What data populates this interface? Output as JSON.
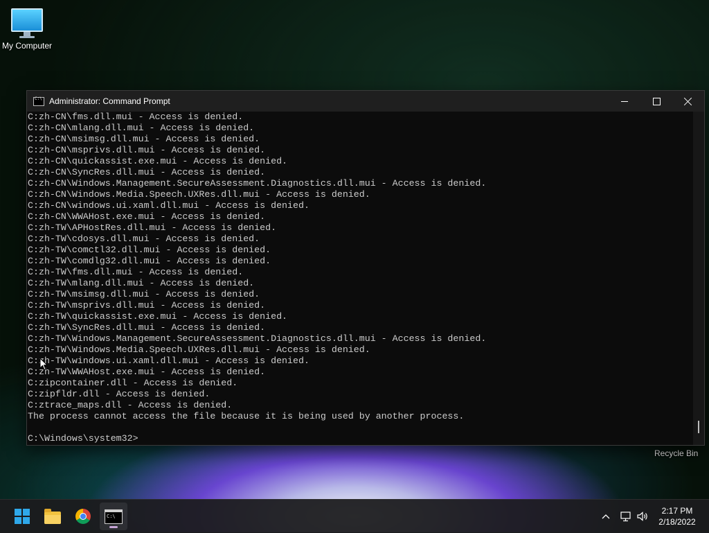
{
  "desktop": {
    "icons": [
      {
        "label": "My Computer",
        "icon": "monitor-icon"
      }
    ],
    "recycle_bin_label": "Recycle Bin"
  },
  "window": {
    "title": "Administrator: Command Prompt",
    "icon": "cmd-icon",
    "controls": {
      "minimize": "minimize-icon",
      "maximize": "maximize-icon",
      "close": "close-icon"
    }
  },
  "console": {
    "lines": [
      "C:zh-CN\\fms.dll.mui - Access is denied.",
      "C:zh-CN\\mlang.dll.mui - Access is denied.",
      "C:zh-CN\\msimsg.dll.mui - Access is denied.",
      "C:zh-CN\\msprivs.dll.mui - Access is denied.",
      "C:zh-CN\\quickassist.exe.mui - Access is denied.",
      "C:zh-CN\\SyncRes.dll.mui - Access is denied.",
      "C:zh-CN\\Windows.Management.SecureAssessment.Diagnostics.dll.mui - Access is denied.",
      "C:zh-CN\\Windows.Media.Speech.UXRes.dll.mui - Access is denied.",
      "C:zh-CN\\windows.ui.xaml.dll.mui - Access is denied.",
      "C:zh-CN\\WWAHost.exe.mui - Access is denied.",
      "C:zh-TW\\APHostRes.dll.mui - Access is denied.",
      "C:zh-TW\\cdosys.dll.mui - Access is denied.",
      "C:zh-TW\\comctl32.dll.mui - Access is denied.",
      "C:zh-TW\\comdlg32.dll.mui - Access is denied.",
      "C:zh-TW\\fms.dll.mui - Access is denied.",
      "C:zh-TW\\mlang.dll.mui - Access is denied.",
      "C:zh-TW\\msimsg.dll.mui - Access is denied.",
      "C:zh-TW\\msprivs.dll.mui - Access is denied.",
      "C:zh-TW\\quickassist.exe.mui - Access is denied.",
      "C:zh-TW\\SyncRes.dll.mui - Access is denied.",
      "C:zh-TW\\Windows.Management.SecureAssessment.Diagnostics.dll.mui - Access is denied.",
      "C:zh-TW\\Windows.Media.Speech.UXRes.dll.mui - Access is denied.",
      "C:zh-TW\\windows.ui.xaml.dll.mui - Access is denied.",
      "C:zh-TW\\WWAHost.exe.mui - Access is denied.",
      "C:zipcontainer.dll - Access is denied.",
      "C:zipfldr.dll - Access is denied.",
      "C:ztrace_maps.dll - Access is denied.",
      "The process cannot access the file because it is being used by another process.",
      "",
      "C:\\Windows\\system32>"
    ]
  },
  "taskbar": {
    "apps": [
      {
        "name": "Start",
        "icon": "windows-start-icon",
        "active": false
      },
      {
        "name": "File Explorer",
        "icon": "folder-icon",
        "active": false
      },
      {
        "name": "Google Chrome",
        "icon": "chrome-icon",
        "active": false
      },
      {
        "name": "Command Prompt",
        "icon": "cmd-icon",
        "active": true
      }
    ],
    "tray": {
      "icons": [
        "chevron-up-icon",
        "network-icon",
        "volume-icon"
      ],
      "time": "2:17 PM",
      "date": "2/18/2022"
    }
  }
}
